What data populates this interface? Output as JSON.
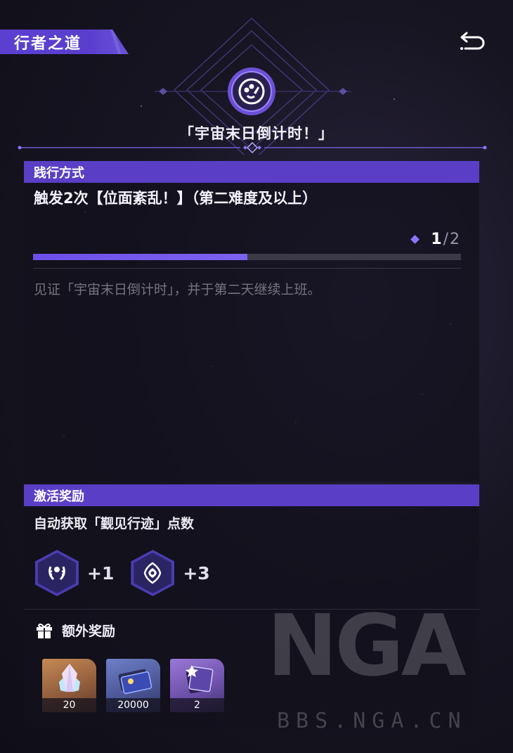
{
  "header": {
    "tag_label": "行者之道",
    "back_icon": "return-icon"
  },
  "achievement": {
    "emblem_icon": "festival-emblem-icon",
    "title": "「宇宙末日倒计时！」"
  },
  "requirement": {
    "section_label": "践行方式",
    "text": "触发2次【位面紊乱！】（第二难度及以上）",
    "progress_current": "1",
    "progress_separator": "/",
    "progress_total": "2",
    "progress_fraction": 0.5,
    "description": "见证「宇宙末日倒计时」，并于第二天继续上班。"
  },
  "reward": {
    "section_label": "激活奖励",
    "description": "自动获取「觐见行迹」点数",
    "points": [
      {
        "icon": "laurel-icon",
        "value": "+1"
      },
      {
        "icon": "eye-sigil-icon",
        "value": "+3"
      }
    ]
  },
  "extra": {
    "label": "额外奖励",
    "icon": "gift-icon",
    "items": [
      {
        "name": "crystal-item",
        "count": "20",
        "quality": "orange"
      },
      {
        "name": "credit-card-item",
        "count": "20000",
        "quality": "blue"
      },
      {
        "name": "pass-card-item",
        "count": "2",
        "quality": "purple"
      }
    ]
  },
  "watermark": {
    "brand": "NGA",
    "url": "BBS.NGA.CN"
  },
  "colors": {
    "accent": "#5a3fc6",
    "progress": "#6c4fe8",
    "background": "#171522"
  }
}
